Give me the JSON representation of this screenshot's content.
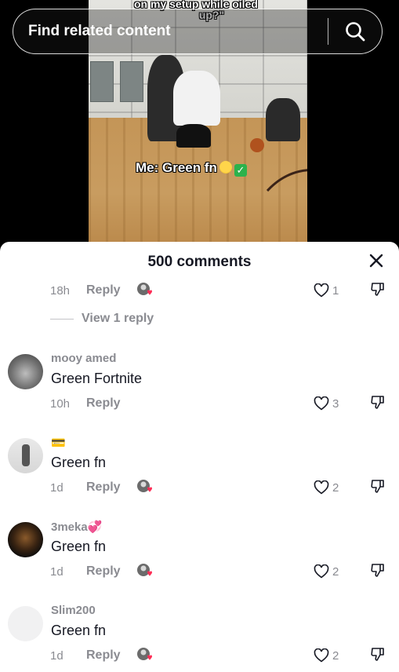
{
  "video": {
    "caption_top_line1": "on my setup while oiled",
    "caption_top_line2": "up?\"",
    "caption_overlay": "Me: Green fn",
    "emoji_1": "money-mouth-face-icon",
    "emoji_2": "check-mark-icon"
  },
  "search": {
    "placeholder": "Find related content",
    "icon": "search-icon"
  },
  "comments_sheet": {
    "title": "500 comments",
    "close_icon": "close-icon",
    "first_meta": {
      "time": "18h",
      "reply_label": "Reply",
      "likes": "1"
    },
    "view_replies": "View 1 reply",
    "comments": [
      {
        "username": "mooy amed",
        "text": "Green Fortnite",
        "time": "10h",
        "reply_label": "Reply",
        "likes": "3"
      },
      {
        "username": "💳",
        "text": "Green fn",
        "time": "1d",
        "reply_label": "Reply",
        "likes": "2"
      },
      {
        "username": "3meka💞",
        "text": "Green fn",
        "time": "1d",
        "reply_label": "Reply",
        "likes": "2"
      },
      {
        "username": "Slim200",
        "text": "Green fn",
        "time": "1d",
        "reply_label": "Reply",
        "likes": "2"
      }
    ]
  },
  "colors": {
    "text_primary": "#161823",
    "text_secondary": "#8a8b91",
    "liked_heart": "#fe2c55"
  }
}
